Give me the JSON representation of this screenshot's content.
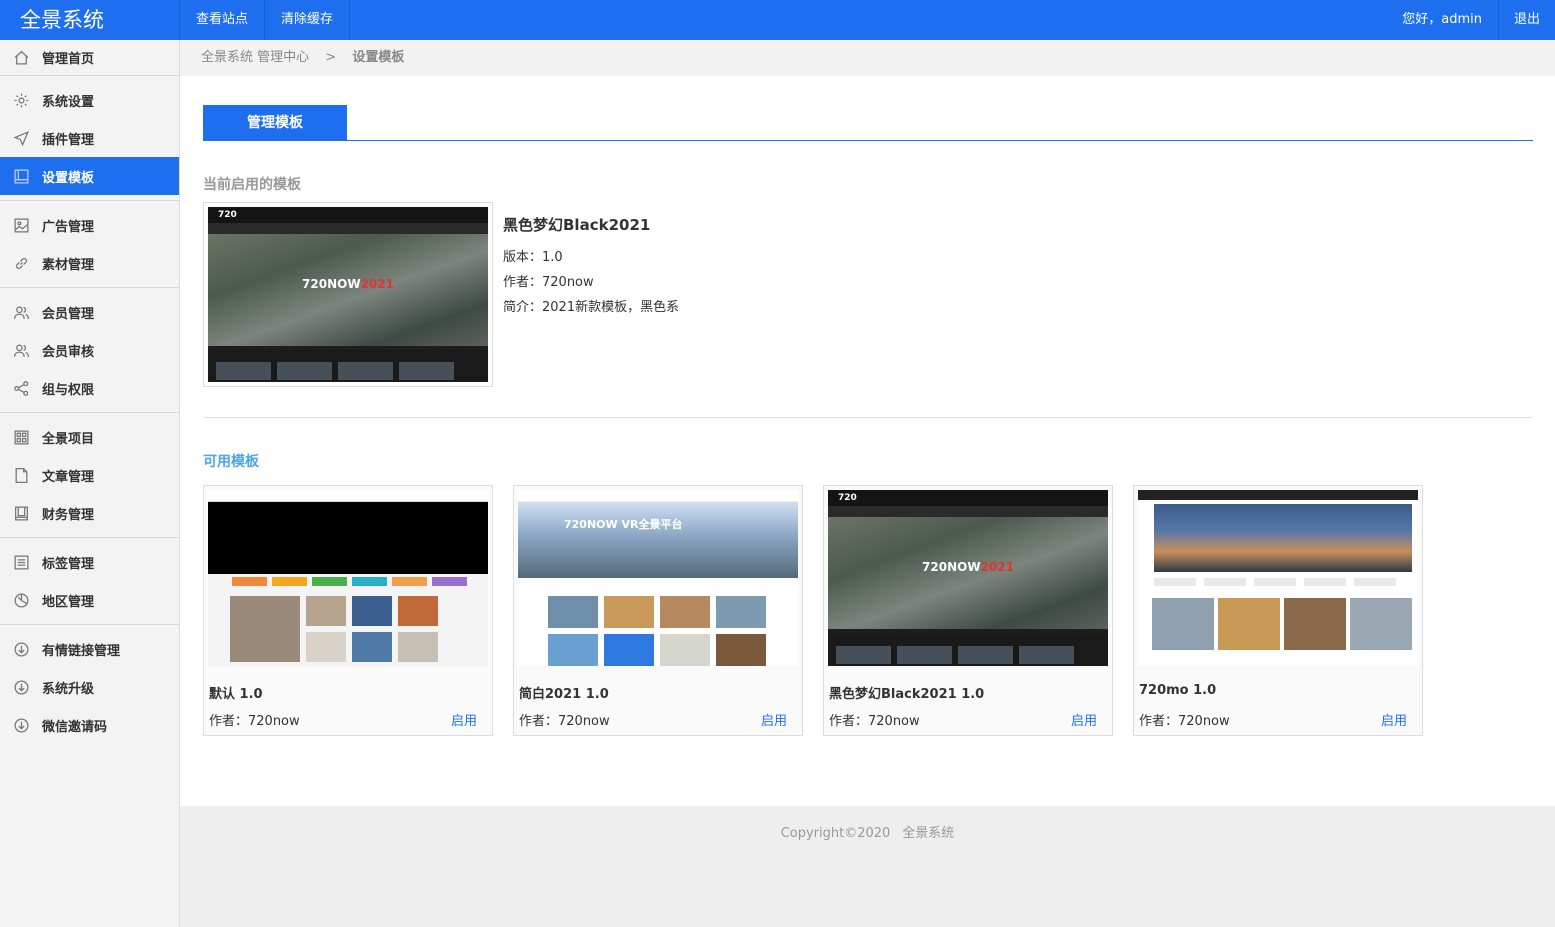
{
  "app": {
    "title": "全景系统"
  },
  "topnav": {
    "items": [
      "查看站点",
      "清除缓存"
    ]
  },
  "user": {
    "greeting": "您好，admin",
    "logout": "退出"
  },
  "sidebar": {
    "groups": [
      [
        {
          "label": "管理首页",
          "icon": "home-icon"
        }
      ],
      [
        {
          "label": "系统设置",
          "icon": "gear-icon"
        },
        {
          "label": "插件管理",
          "icon": "send-icon"
        },
        {
          "label": "设置模板",
          "icon": "template-icon",
          "active": true
        }
      ],
      [
        {
          "label": "广告管理",
          "icon": "image-icon"
        },
        {
          "label": "素材管理",
          "icon": "link-icon"
        }
      ],
      [
        {
          "label": "会员管理",
          "icon": "users-icon"
        },
        {
          "label": "会员审核",
          "icon": "users-icon"
        },
        {
          "label": "组与权限",
          "icon": "share-icon"
        }
      ],
      [
        {
          "label": "全景项目",
          "icon": "grid-icon"
        },
        {
          "label": "文章管理",
          "icon": "file-icon"
        },
        {
          "label": "财务管理",
          "icon": "book-icon"
        }
      ],
      [
        {
          "label": "标签管理",
          "icon": "list-icon"
        },
        {
          "label": "地区管理",
          "icon": "pie-icon"
        }
      ],
      [
        {
          "label": "有情链接管理",
          "icon": "download-circle-icon"
        },
        {
          "label": "系统升级",
          "icon": "download-circle-icon"
        },
        {
          "label": "微信邀请码",
          "icon": "download-circle-icon"
        }
      ]
    ]
  },
  "breadcrumb": {
    "root": "全景系统 管理中心",
    "sep": ">",
    "current": "设置模板"
  },
  "tab": {
    "label": "管理模板"
  },
  "current_section": {
    "title": "当前启用的模板"
  },
  "current_template": {
    "name": "黑色梦幻Black2021",
    "version": "版本：1.0",
    "author": "作者：720now",
    "intro": "简介：2021新款模板，黑色系",
    "thumb_title": "720NOW",
    "thumb_title_accent": "2021"
  },
  "available_section": {
    "title": "可用模板"
  },
  "templates": [
    {
      "name": "默认 1.0",
      "author": "作者：720now",
      "action": "启用",
      "thumb": "default"
    },
    {
      "name": "简白2021 1.0",
      "author": "作者：720now",
      "action": "启用",
      "thumb": "white",
      "thumb_title": "720NOW VR全景平台"
    },
    {
      "name": "黑色梦幻Black2021 1.0",
      "author": "作者：720now",
      "action": "启用",
      "thumb": "dark",
      "thumb_title": "720NOW",
      "thumb_title_accent": "2021"
    },
    {
      "name": "720mo 1.0",
      "author": "作者：720now",
      "action": "启用",
      "thumb": "mo"
    }
  ],
  "footer": {
    "copyright": "Copyright©2020",
    "brand": "全景系统"
  },
  "colors": {
    "primary": "#1e6ff0",
    "link": "#4da3ee"
  }
}
